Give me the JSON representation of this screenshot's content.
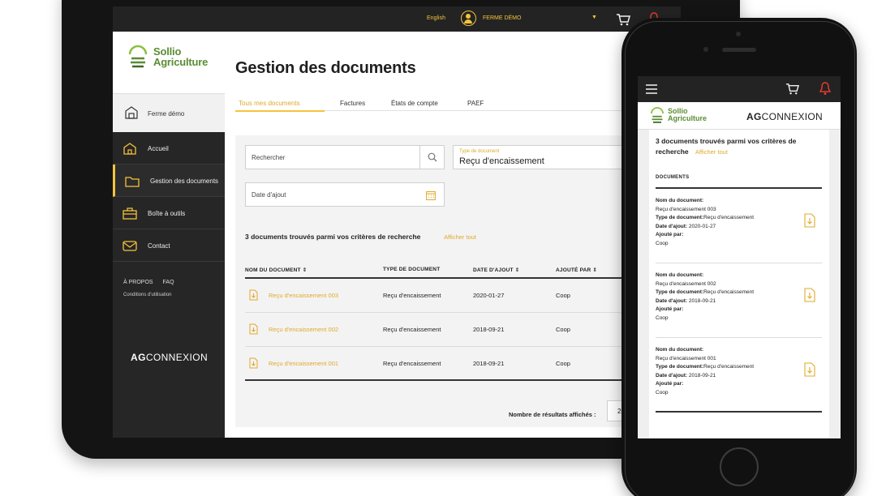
{
  "colors": {
    "accent": "#f5c33b",
    "accent_text": "#e0a92a",
    "brand_green": "#5b8c33",
    "dark": "#232323",
    "sidebar": "#262626"
  },
  "tablet": {
    "topbar": {
      "language": "English",
      "user_name": "FERME DÉMO",
      "icons": [
        "user-icon",
        "chevron-down-icon",
        "cart-icon",
        "bell-icon"
      ]
    },
    "sidebar": {
      "brand_line1": "Sollio",
      "brand_line2": "Agriculture",
      "farm_label": "Ferme démo",
      "items": [
        {
          "label": "Accueil",
          "icon": "home-icon"
        },
        {
          "label": "Gestion des documents",
          "icon": "folder-icon"
        },
        {
          "label": "Boîte à outils",
          "icon": "toolbox-icon"
        },
        {
          "label": "Contact",
          "icon": "contact-icon"
        }
      ],
      "footer_links": [
        "À PROPOS",
        "FAQ"
      ],
      "terms": "Conditions d'utilisation",
      "agcon_bold": "AG",
      "agcon_rest": "CONNEXION"
    },
    "main": {
      "title": "Gestion des documents",
      "tabs": [
        "Tous mes documents",
        "Factures",
        "États de compte",
        "PAEF"
      ],
      "search_placeholder": "Rechercher",
      "type_label": "Type de document",
      "type_value": "Reçu d'encaissement",
      "date_placeholder": "Date d'ajout",
      "found_text": "3 documents trouvés parmi vos critères de recherche",
      "show_all": "Afficher tout",
      "columns": [
        "NOM DU DOCUMENT",
        "TYPE DE DOCUMENT",
        "DATE D'AJOUT",
        "AJOUTÉ PAR"
      ],
      "rows": [
        {
          "name": "Reçu d'encaissement 003",
          "type": "Reçu d'encaissement",
          "date": "2020-01-27",
          "by": "Coop"
        },
        {
          "name": "Reçu d'encaissement 002",
          "type": "Reçu d'encaissement",
          "date": "2018-09-21",
          "by": "Coop"
        },
        {
          "name": "Reçu d'encaissement 001",
          "type": "Reçu d'encaissement",
          "date": "2018-09-21",
          "by": "Coop"
        }
      ],
      "results_label": "Nombre de résultats affichés :",
      "results_value": "20"
    }
  },
  "phone": {
    "brand_line1": "Sollio",
    "brand_line2": "Agriculture",
    "agcon_bold": "AG",
    "agcon_rest": "CONNEXION",
    "found_text": "3 documents trouvés parmi vos critères de recherche",
    "show_all": "Afficher tout",
    "section_label": "DOCUMENTS",
    "field_labels": {
      "name": "Nom du document:",
      "type": "Type de document:",
      "date": "Date d'ajout:",
      "by": "Ajouté par:"
    },
    "items": [
      {
        "name": "Reçu d'encaissement 003",
        "type": "Reçu d'encaissement",
        "date": "2020-01-27",
        "by": "Coop"
      },
      {
        "name": "Reçu d'encaissement 002",
        "type": "Reçu d'encaissement",
        "date": "2018-09-21",
        "by": "Coop"
      },
      {
        "name": "Reçu d'encaissement 001",
        "type": "Reçu d'encaissement",
        "date": "2018-09-21",
        "by": "Coop"
      }
    ]
  }
}
